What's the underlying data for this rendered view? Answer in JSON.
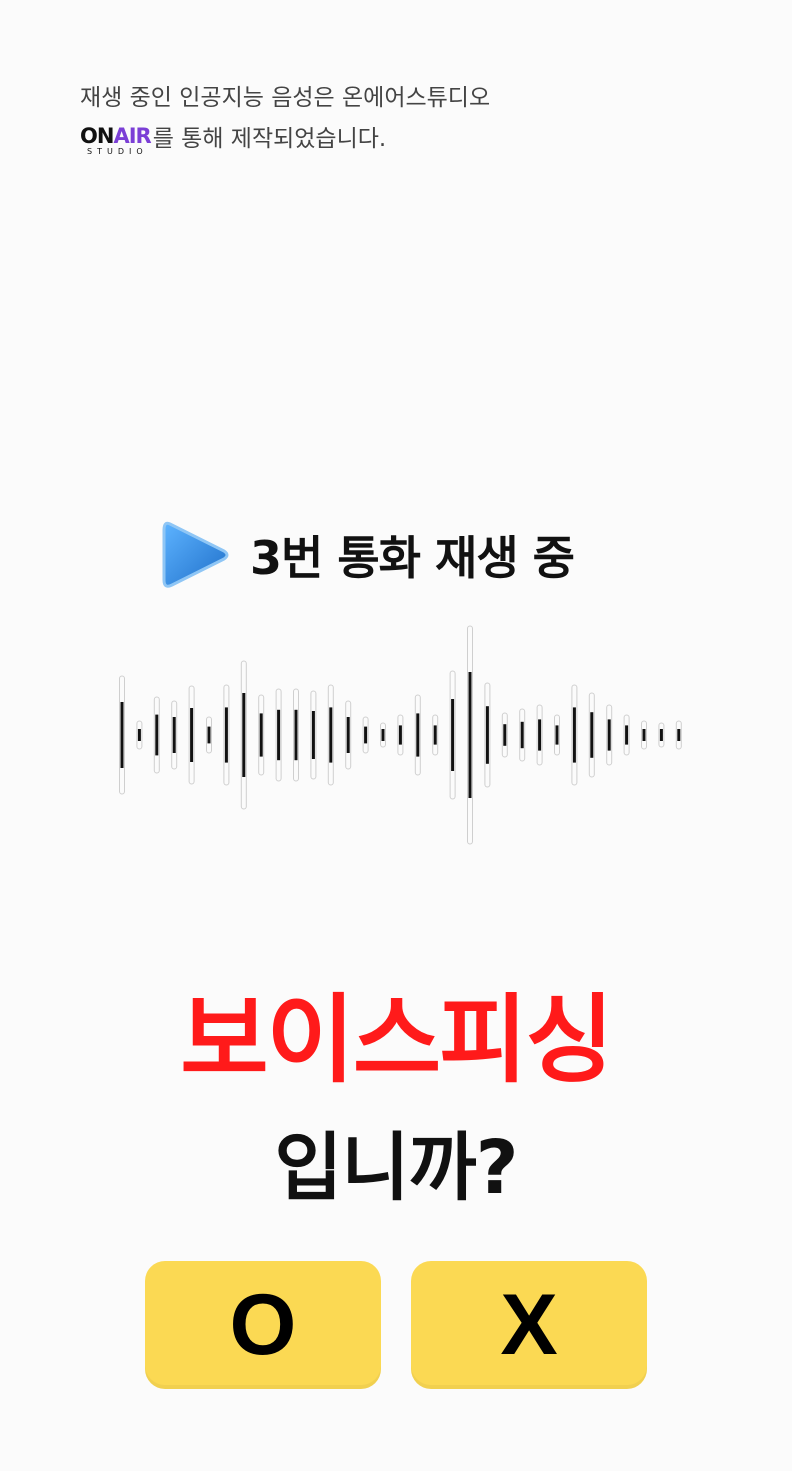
{
  "notice": {
    "line1": "재생 중인 인공지능 음성은 온에어스튜디오",
    "logo_on": "ON",
    "logo_air": "AIR",
    "logo_sub": "STUDIO",
    "line2": "를 통해 제작되었습니다."
  },
  "status": {
    "icon": "play-icon",
    "text": "3번 통화 재생 중"
  },
  "question": {
    "keyword": "보이스피싱",
    "suffix": "입니까?"
  },
  "buttons": {
    "o_label": "O",
    "x_label": "X"
  },
  "colors": {
    "keyword": "#ff1a1a",
    "button": "#fbd953",
    "play_icon": "#2e86de"
  }
}
